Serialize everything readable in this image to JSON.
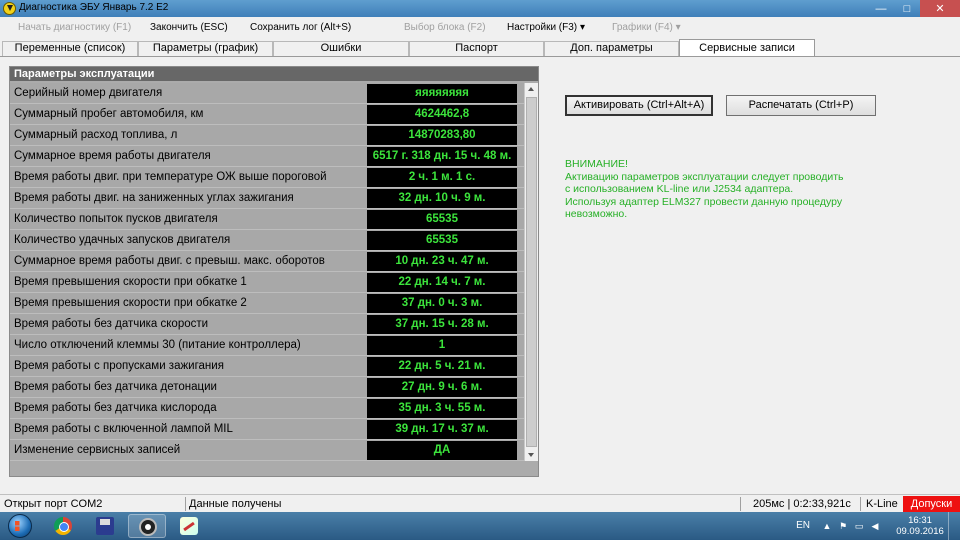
{
  "window": {
    "title": "Диагностика ЭБУ Январь 7.2 Е2",
    "minimize": "—",
    "maximize": "□",
    "close": "✕"
  },
  "menu": {
    "items": [
      {
        "label": "Начать диагностику (F1)",
        "enabled": false
      },
      {
        "label": "Закончить (ESC)",
        "enabled": true
      },
      {
        "label": "Сохранить лог (Alt+S)",
        "enabled": true
      },
      {
        "label": "Выбор блока (F2)",
        "enabled": false
      },
      {
        "label": "Настройки (F3)",
        "enabled": true,
        "dropdown": true
      },
      {
        "label": "Графики (F4)",
        "enabled": false,
        "dropdown": true
      }
    ],
    "dropdown_glyph": "▾"
  },
  "tabs": [
    {
      "label": "Переменные (список)",
      "active": false
    },
    {
      "label": "Параметры (график)",
      "active": false
    },
    {
      "label": "Ошибки",
      "active": false
    },
    {
      "label": "Паспорт",
      "active": false
    },
    {
      "label": "Доп. параметры",
      "active": false
    },
    {
      "label": "Сервисные записи",
      "active": true
    }
  ],
  "panel": {
    "title": "Параметры эксплуатации",
    "rows": [
      {
        "label": "Серийный номер двигателя",
        "value": "яяяяяяяя"
      },
      {
        "label": "Суммарный пробег автомобиля, км",
        "value": "4624462,8"
      },
      {
        "label": "Суммарный расход топлива, л",
        "value": "14870283,80"
      },
      {
        "label": "Суммарное время работы двигателя",
        "value": "6517 г. 318 дн. 15 ч. 48 м."
      },
      {
        "label": "Время работы двиг. при температуре ОЖ выше пороговой",
        "value": "2 ч. 1 м. 1 с."
      },
      {
        "label": "Время работы двиг. на заниженных углах зажигания",
        "value": "32 дн. 10 ч. 9 м."
      },
      {
        "label": "Количество попыток пусков двигателя",
        "value": "65535"
      },
      {
        "label": "Количество удачных запусков двигателя",
        "value": "65535"
      },
      {
        "label": "Суммарное время работы двиг. с превыш. макс. оборотов",
        "value": "10 дн. 23 ч. 47 м."
      },
      {
        "label": "Время превышения скорости при обкатке 1",
        "value": "22 дн. 14 ч. 7 м."
      },
      {
        "label": "Время превышения скорости при обкатке 2",
        "value": "37 дн. 0 ч. 3 м."
      },
      {
        "label": "Время работы без датчика скорости",
        "value": "37 дн. 15 ч. 28 м."
      },
      {
        "label": "Число отключений клеммы 30 (питание контроллера)",
        "value": "1"
      },
      {
        "label": "Время работы с пропусками зажигания",
        "value": "22 дн. 5 ч. 21 м."
      },
      {
        "label": "Время работы без датчика детонации",
        "value": "27 дн. 9 ч. 6 м."
      },
      {
        "label": "Время работы без датчика кислорода",
        "value": "35 дн. 3 ч. 55 м."
      },
      {
        "label": "Время работы с включенной лампой MIL",
        "value": "39 дн. 17 ч. 37 м."
      },
      {
        "label": "Изменение сервисных записей",
        "value": "ДА"
      }
    ]
  },
  "buttons": {
    "activate": "Активировать (Ctrl+Alt+A)",
    "print": "Распечатать (Ctrl+P)"
  },
  "warning": {
    "lines": [
      "ВНИМАНИЕ!",
      "Активацию параметров эксплуатации следует проводить",
      "с использованием KL-line или J2534 адаптера.",
      "Используя адаптер ELM327 провести данную процедуру",
      "невозможно."
    ]
  },
  "status": {
    "port": "Открыт порт COM2",
    "data": "Данные получены",
    "timing": "205мс | 0:2:33,921с",
    "line": "K-Line",
    "mode": "Допуски"
  },
  "taskbar": {
    "apps": [
      "chrome-icon",
      "save-disk-icon",
      "diagnostics-icon",
      "paint-icon"
    ],
    "lang": "EN",
    "time": "16:31",
    "date": "09.09.2016"
  },
  "colors": {
    "value_text": "#3ce43c",
    "warning_text": "#27b027",
    "alert_bg": "#e11111"
  }
}
